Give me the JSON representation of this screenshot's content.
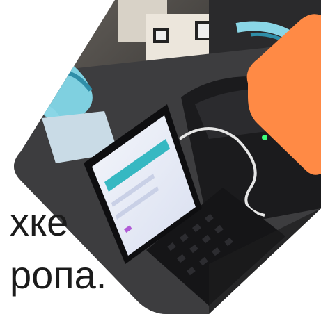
{
  "caption": {
    "line_1": "хке",
    "line_2": "ропа."
  },
  "colors": {
    "accent": "#ff8a45",
    "caption_text": "#1b1b1b",
    "background": "#ffffff"
  },
  "icons": {
    "photo": "photo-of-badge-printing-station"
  }
}
